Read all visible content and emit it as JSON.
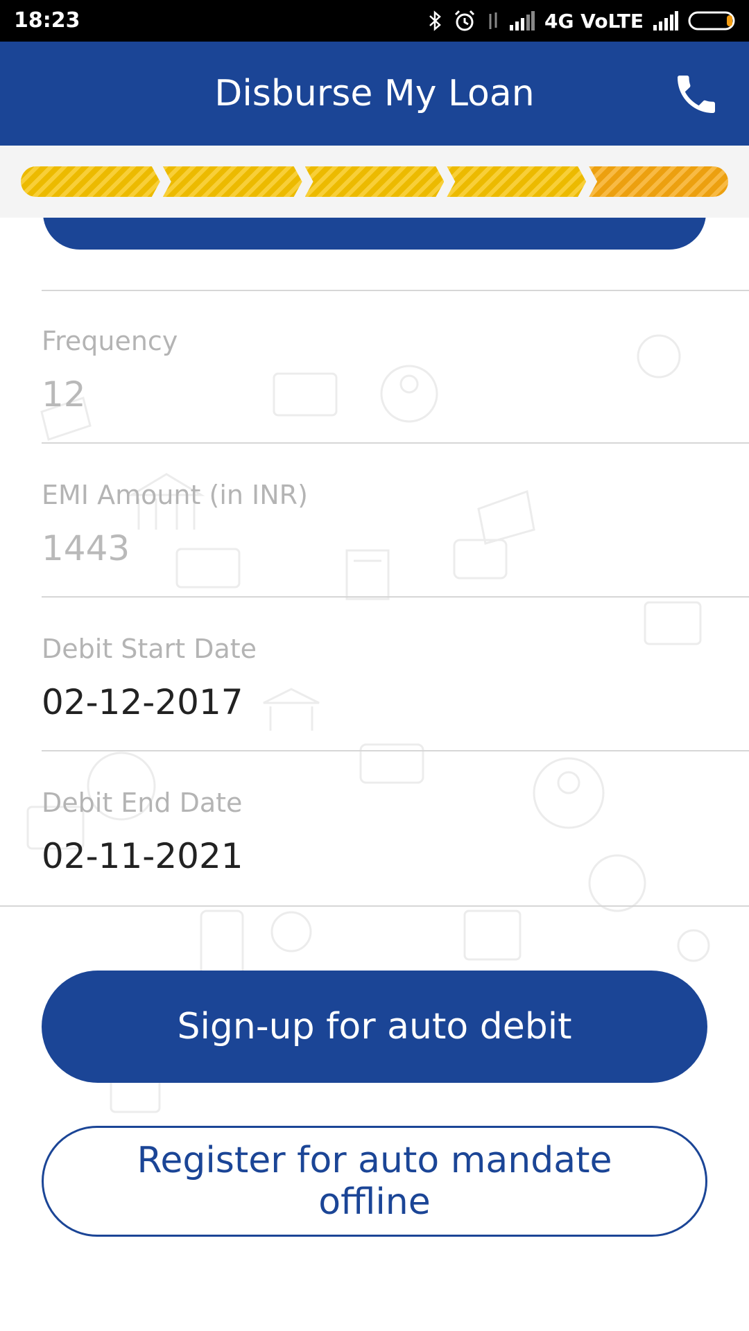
{
  "status_bar": {
    "time": "18:23",
    "network_label": "4G VoLTE",
    "icons": [
      "bluetooth-icon",
      "alarm-icon",
      "data-transfer-icon",
      "signal-icon",
      "signal-icon",
      "battery-icon"
    ]
  },
  "header": {
    "title": "Disburse My Loan",
    "call_icon": "phone-icon"
  },
  "progress": {
    "steps_total": 5,
    "current_step": 5
  },
  "fields": [
    {
      "label": "Frequency",
      "value": "12",
      "state": "disabled"
    },
    {
      "label": "EMI Amount (in INR)",
      "value": "1443",
      "state": "disabled"
    },
    {
      "label": "Debit Start Date",
      "value": "02-12-2017",
      "state": "active"
    },
    {
      "label": "Debit End Date",
      "value": "02-11-2021",
      "state": "active"
    }
  ],
  "actions": {
    "primary_label": "Sign-up for auto debit",
    "secondary_label": "Register for auto mandate offline"
  },
  "colors": {
    "brand_blue": "#1b4596",
    "progress_yellow": "#f6c200",
    "progress_orange": "#f6a710"
  }
}
